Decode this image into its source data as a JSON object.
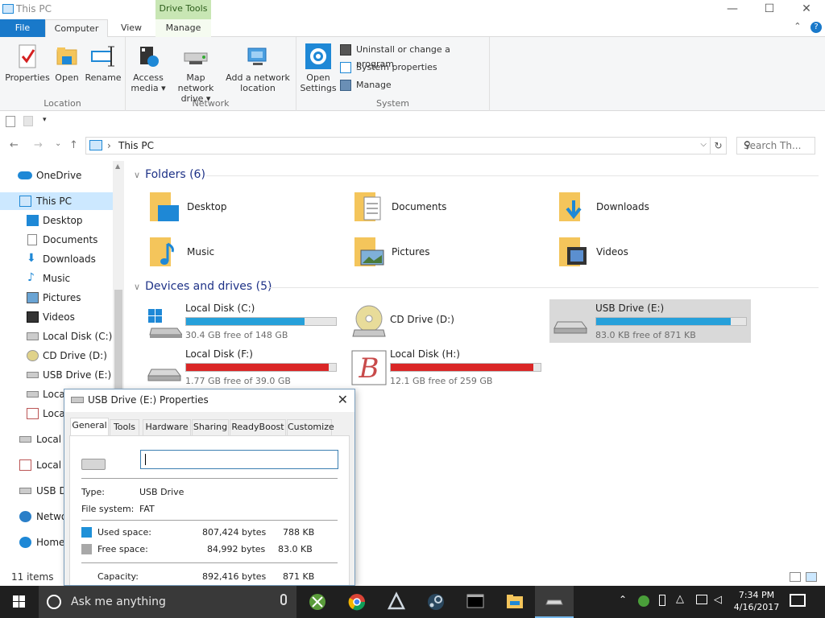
{
  "window": {
    "title": "This PC",
    "context_tab": "Drive Tools",
    "controls": {
      "minimize": "—",
      "maximize": "☐",
      "close": "✕"
    }
  },
  "ribbon_tabs": [
    {
      "label": "File"
    },
    {
      "label": "Computer"
    },
    {
      "label": "View"
    },
    {
      "label": "Manage"
    }
  ],
  "ribbon": {
    "location": {
      "label": "Location",
      "buttons": [
        "Properties",
        "Open",
        "Rename"
      ]
    },
    "network": {
      "label": "Network",
      "buttons": [
        {
          "line1": "Access",
          "line2": "media ▾"
        },
        {
          "line1": "Map network",
          "line2": "drive ▾"
        },
        {
          "line1": "Add a network",
          "line2": "location"
        }
      ]
    },
    "system": {
      "label": "System",
      "open_settings": {
        "line1": "Open",
        "line2": "Settings"
      },
      "items": [
        "Uninstall or change a program",
        "System properties",
        "Manage"
      ]
    }
  },
  "nav": {
    "back": "←",
    "forward": "→",
    "recent": "⌄",
    "up": "↑",
    "crumb_sep": "›",
    "breadcrumb": "This PC",
    "dropdown": "⌵",
    "refresh": "↻",
    "search_placeholder": "Search Th...",
    "search_icon": "⚲"
  },
  "sidebar": [
    {
      "label": "OneDrive",
      "icon": "onedrive-icon"
    },
    {
      "label": "This PC",
      "icon": "pc-icon",
      "selected": true
    },
    {
      "label": "Desktop",
      "icon": "desktop-icon"
    },
    {
      "label": "Documents",
      "icon": "documents-icon"
    },
    {
      "label": "Downloads",
      "icon": "downloads-icon"
    },
    {
      "label": "Music",
      "icon": "music-icon"
    },
    {
      "label": "Pictures",
      "icon": "pictures-icon"
    },
    {
      "label": "Videos",
      "icon": "videos-icon"
    },
    {
      "label": "Local Disk (C:)",
      "icon": "drive-icon"
    },
    {
      "label": "CD Drive (D:)",
      "icon": "cd-icon"
    },
    {
      "label": "USB Drive (E:)",
      "icon": "usb-icon"
    },
    {
      "label": "Loca",
      "icon": "drive-icon"
    },
    {
      "label": "Loca",
      "icon": "drive-icon"
    },
    {
      "label": "Local",
      "icon": "drive-icon"
    },
    {
      "label": "Local",
      "icon": "drive-icon"
    },
    {
      "label": "USB D",
      "icon": "usb-icon"
    },
    {
      "label": "Netwo",
      "icon": "network-icon"
    },
    {
      "label": "Home",
      "icon": "homegroup-icon"
    }
  ],
  "folders_group": {
    "title": "Folders (6)",
    "items": [
      "Desktop",
      "Documents",
      "Downloads",
      "Music",
      "Pictures",
      "Videos"
    ]
  },
  "drives_group": {
    "title": "Devices and drives (5)",
    "items": [
      {
        "label": "Local Disk (C:)",
        "free": "30.4 GB free of 148 GB",
        "used": 0.79,
        "color": "#26a0da",
        "icon": "windows-drive-icon"
      },
      {
        "label": "CD Drive (D:)",
        "free": "",
        "used": 0,
        "color": "",
        "icon": "cd-drive-icon"
      },
      {
        "label": "USB Drive (E:)",
        "free": "83.0 KB free of 871 KB",
        "used": 0.9,
        "color": "#26a0da",
        "icon": "usb-drive-icon",
        "selected": true
      },
      {
        "label": "Local Disk (F:)",
        "free": "1.77 GB free of 39.0 GB",
        "used": 0.95,
        "color": "#da2626",
        "icon": "drive-icon"
      },
      {
        "label": "Local Disk (H:)",
        "free": "12.1 GB free of 259 GB",
        "used": 0.95,
        "color": "#da2626",
        "icon": "custom-drive-icon"
      }
    ]
  },
  "status": {
    "items": "11 items"
  },
  "dialog": {
    "title": "USB Drive (E:) Properties",
    "close": "✕",
    "tabs": [
      "General",
      "Tools",
      "Hardware",
      "Sharing",
      "ReadyBoost",
      "Customize"
    ],
    "name_value": "",
    "type_label": "Type:",
    "type_value": "USB Drive",
    "fs_label": "File system:",
    "fs_value": "FAT",
    "used_label": "Used space:",
    "used_bytes": "807,424 bytes",
    "used_size": "788 KB",
    "free_label": "Free space:",
    "free_bytes": "84,992 bytes",
    "free_size": "83.0 KB",
    "capacity_label": "Capacity:",
    "capacity_bytes": "892,416 bytes",
    "capacity_size": "871 KB",
    "used_color": "#1e90d8",
    "free_color": "#a8a8a8"
  },
  "taskbar": {
    "search_text": "Ask me anything",
    "apps": [
      "xbox-app",
      "chrome-app",
      "unity-app",
      "steam-app",
      "cmd-app",
      "explorer-app",
      "usb-app"
    ],
    "time": "7:34 PM",
    "date": "4/16/2017"
  }
}
